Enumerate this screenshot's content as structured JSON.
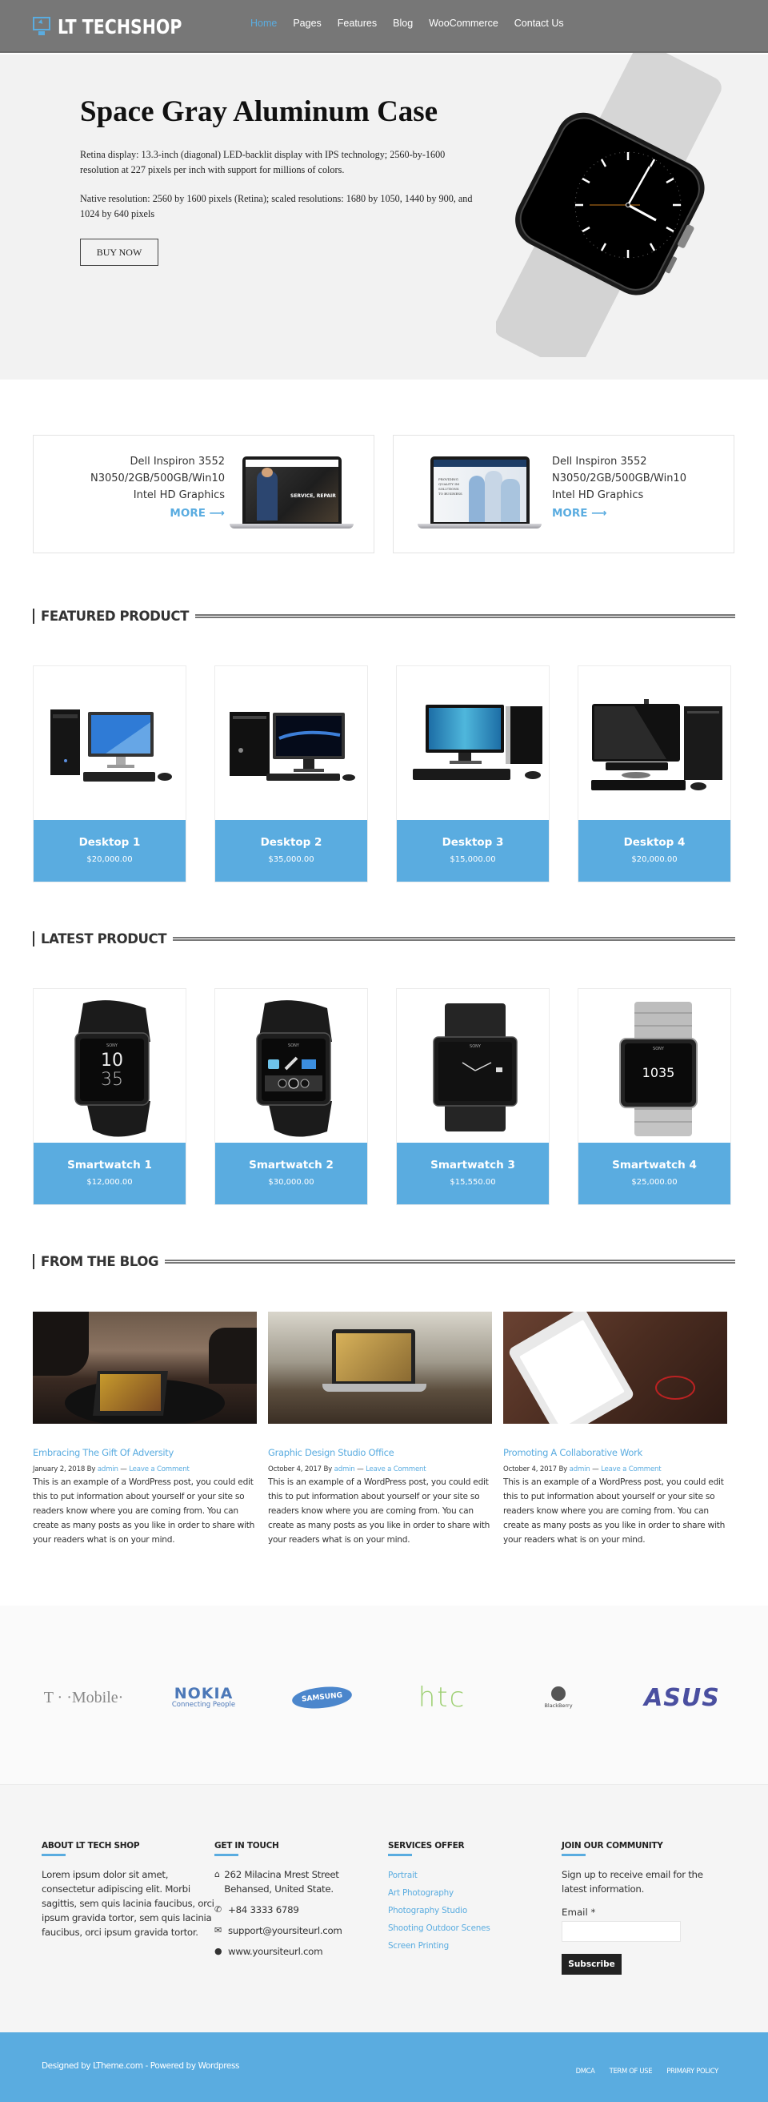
{
  "header": {
    "logo_text": "LT TECHSHOP",
    "nav": [
      {
        "label": "Home",
        "active": true
      },
      {
        "label": "Pages",
        "active": false
      },
      {
        "label": "Features",
        "active": false
      },
      {
        "label": "Blog",
        "active": false
      },
      {
        "label": "WooCommerce",
        "active": false
      },
      {
        "label": "Contact Us",
        "active": false
      }
    ]
  },
  "hero": {
    "title": "Space Gray Aluminum Case",
    "paragraph1": "Retina display: 13.3-inch (diagonal) LED-backlit display with IPS technology; 2560-by-1600 resolution at 227 pixels per inch with support for millions of colors.",
    "paragraph2": "Native resolution: 2560 by 1600 pixels (Retina); scaled resolutions: 1680 by 1050, 1440 by 900, and 1024 by 640 pixels",
    "button": "BUY NOW"
  },
  "promos": [
    {
      "line1": "Dell Inspiron 3552",
      "line2": "N3050/2GB/500GB/Win10",
      "line3": "Intel HD Graphics",
      "more": "MORE ⟶",
      "screen_caption": "SERVICE, REPAIR"
    },
    {
      "line1": "Dell Inspiron 3552",
      "line2": "N3050/2GB/500GB/Win10",
      "line3": "Intel HD Graphics",
      "more": "MORE ⟶",
      "screen_caption": "PROVIDING QUALITY IM SOLUTIONS TO BUSINESS"
    }
  ],
  "featured": {
    "heading": "FEATURED PRODUCT",
    "products": [
      {
        "name": "Desktop 1",
        "price": "$20,000.00"
      },
      {
        "name": "Desktop 2",
        "price": "$35,000.00"
      },
      {
        "name": "Desktop 3",
        "price": "$15,000.00"
      },
      {
        "name": "Desktop 4",
        "price": "$20,000.00"
      }
    ]
  },
  "latest": {
    "heading": "LATEST PRODUCT",
    "products": [
      {
        "name": "Smartwatch 1",
        "price": "$12,000.00",
        "brand": "SONY",
        "screen": "10 35"
      },
      {
        "name": "Smartwatch 2",
        "price": "$30,000.00",
        "brand": "SONY",
        "screen": "apps"
      },
      {
        "name": "Smartwatch 3",
        "price": "$15,550.00",
        "brand": "SONY",
        "screen": "analog"
      },
      {
        "name": "Smartwatch 4",
        "price": "$25,000.00",
        "brand": "SONY",
        "screen": "1035"
      }
    ]
  },
  "blog": {
    "heading": "FROM THE BLOG",
    "posts": [
      {
        "title": "Embracing The Gift Of Adversity",
        "date": "January 2, 2018",
        "by": "By",
        "author": "admin",
        "sep": "—",
        "comment": "Leave a Comment",
        "excerpt": "This is an example of a WordPress post, you could edit this to put information about yourself or your site so readers know where you are coming from. You can create as many posts as you like in order to share with your readers what is on your mind."
      },
      {
        "title": "Graphic Design Studio Office",
        "date": "October 4, 2017",
        "by": "By",
        "author": "admin",
        "sep": "—",
        "comment": "Leave a Comment",
        "excerpt": "This is an example of a WordPress post, you could edit this to put information about yourself or your site so readers know where you are coming from. You can create as many posts as you like in order to share with your readers what is on your mind."
      },
      {
        "title": "Promoting A Collaborative Work",
        "date": "October 4, 2017",
        "by": "By",
        "author": "admin",
        "sep": "—",
        "comment": "Leave a Comment",
        "excerpt": "This is an example of a WordPress post, you could edit this to put information about yourself or your site so readers know where you are coming from. You can create as many posts as you like in order to share with your readers what is on your mind."
      }
    ]
  },
  "brands": [
    {
      "name": "T-Mobile",
      "label": "T · ·Mobile·",
      "color": "#e20074"
    },
    {
      "name": "Nokia",
      "label": "NOKIA",
      "sub": "Connecting People",
      "color": "#2c5fa8"
    },
    {
      "name": "Samsung",
      "label": "SAMSUNG",
      "color": "#1f62b8"
    },
    {
      "name": "HTC",
      "label": "htc",
      "color": "#8cc63f"
    },
    {
      "name": "BlackBerry",
      "label": "BlackBerry",
      "color": "#555555"
    },
    {
      "name": "ASUS",
      "label": "ASUS",
      "color": "#3b3f95"
    }
  ],
  "footer": {
    "about": {
      "heading": "ABOUT LT TECH SHOP",
      "text": "Lorem ipsum dolor sit amet, consectetur adipiscing elit. Morbi sagittis, sem quis lacinia faucibus, orci ipsum gravida tortor, sem quis lacinia faucibus, orci ipsum gravida tortor."
    },
    "contact": {
      "heading": "GET IN TOUCH",
      "address": "262 Milacina Mrest Street Behansed, United State.",
      "phone": "+84 3333 6789",
      "email": "support@yoursiteurl.com",
      "website": "www.yoursiteurl.com"
    },
    "services": {
      "heading": "SERVICES OFFER",
      "links": [
        "Portrait",
        "Art Photography",
        "Photography Studio",
        "Shooting Outdoor Scenes",
        "Screen Printing"
      ]
    },
    "community": {
      "heading": "JOIN OUR COMMUNITY",
      "text": "Sign up to receive email for the latest information.",
      "email_label": "Email *",
      "email_value": "",
      "button": "Subscribe"
    }
  },
  "bottom_bar": {
    "credit": "Designed by LTheme.com - Powered by Wordpress",
    "links": [
      "DMCA",
      "TERM OF USE",
      "PRIMARY POLICY"
    ]
  },
  "colors": {
    "accent": "#5aace0",
    "header_bg": "#777777",
    "hero_bg": "#f2f2f2",
    "footer_bg": "#f5f5f5"
  }
}
